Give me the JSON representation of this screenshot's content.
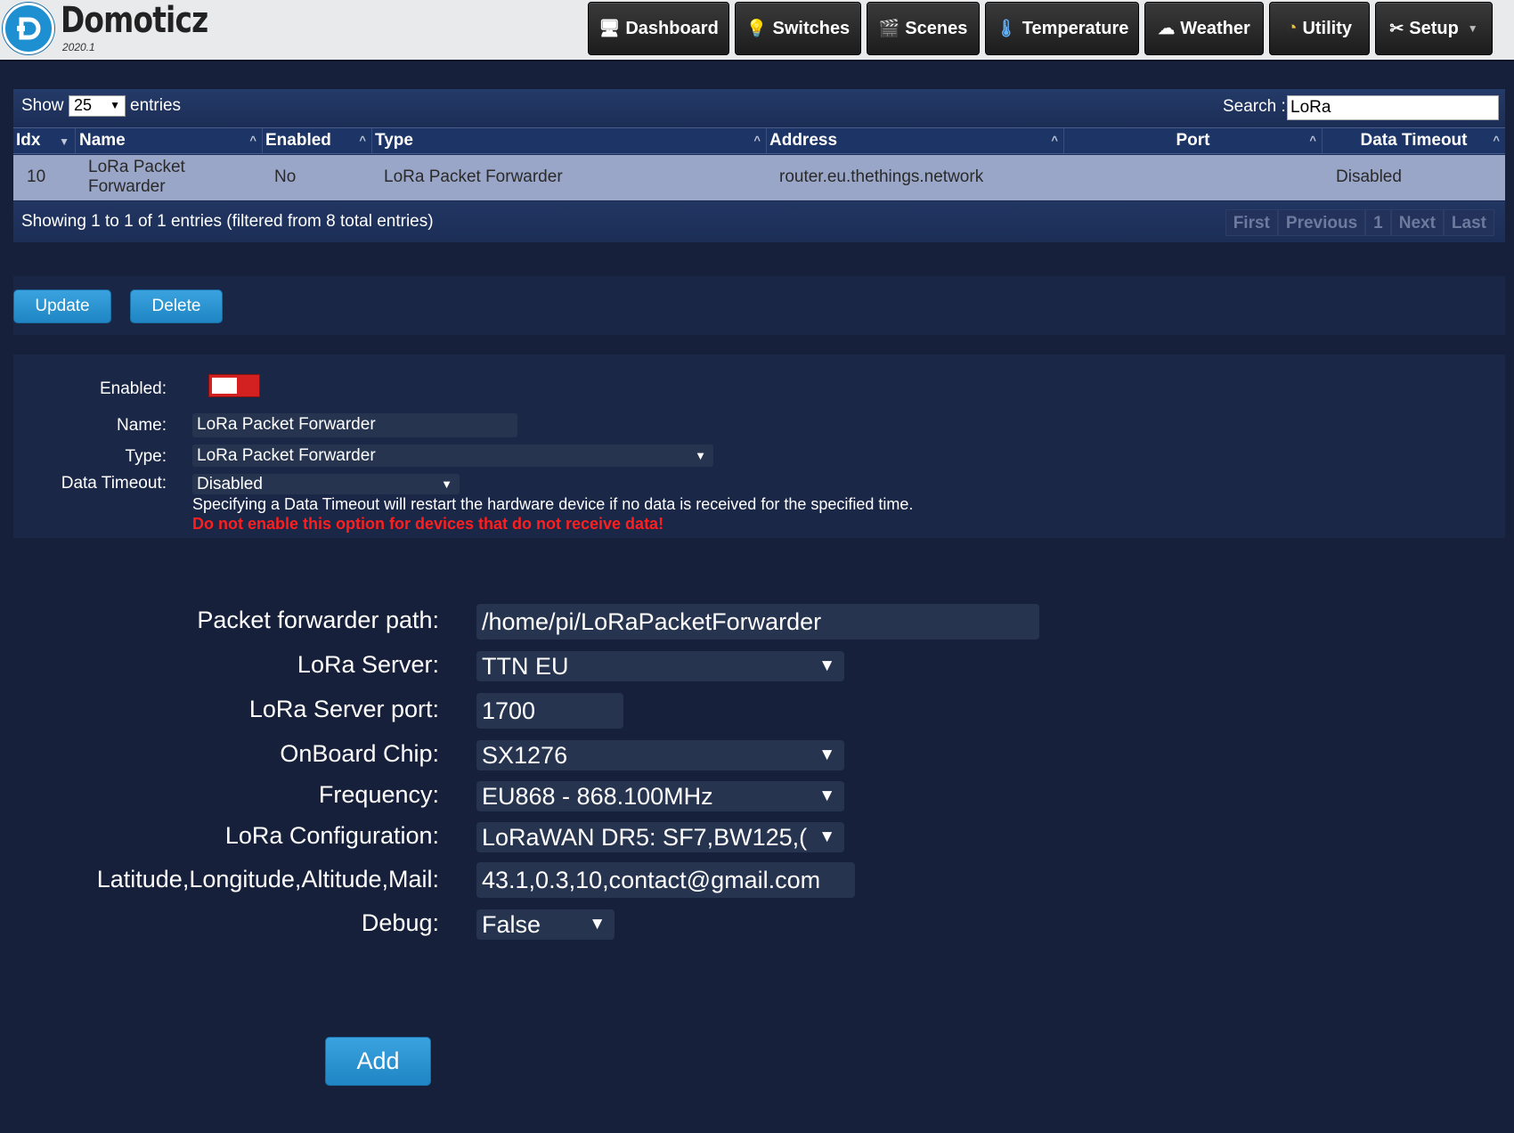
{
  "app": {
    "name": "Domoticz",
    "version": "2020.1"
  },
  "nav": [
    {
      "label": "Dashboard",
      "icon": "dashboard-icon"
    },
    {
      "label": "Switches",
      "icon": "bulb-icon"
    },
    {
      "label": "Scenes",
      "icon": "clapper-icon"
    },
    {
      "label": "Temperature",
      "icon": "thermometer-icon"
    },
    {
      "label": "Weather",
      "icon": "cloud-icon"
    },
    {
      "label": "Utility",
      "icon": "gauge-icon"
    },
    {
      "label": "Setup",
      "icon": "tools-icon"
    }
  ],
  "table": {
    "show_label": "Show",
    "show_value": "25",
    "entries_label": "entries",
    "search_label": "Search :",
    "search_value": "LoRa",
    "columns": [
      "Idx",
      "Name",
      "Enabled",
      "Type",
      "Address",
      "Port",
      "Data Timeout"
    ],
    "rows": [
      {
        "idx": "10",
        "name_line1": "LoRa Packet",
        "name_line2": "Forwarder",
        "enabled": "No",
        "type": "LoRa Packet Forwarder",
        "address": "router.eu.thethings.network",
        "port": "",
        "timeout": "Disabled"
      }
    ],
    "info": "Showing 1 to 1 of 1 entries (filtered from 8 total entries)",
    "paging": [
      "First",
      "Previous",
      "1",
      "Next",
      "Last"
    ]
  },
  "actions": {
    "update": "Update",
    "delete": "Delete"
  },
  "hardware": {
    "enabled_label": "Enabled:",
    "enabled": false,
    "name_label": "Name:",
    "name_value": "LoRa Packet Forwarder",
    "type_label": "Type:",
    "type_value": "LoRa Packet Forwarder",
    "timeout_label": "Data Timeout:",
    "timeout_value": "Disabled",
    "timeout_help": "Specifying a Data Timeout will restart the hardware device if no data is received for the specified time.",
    "timeout_warning": "Do not enable this option for devices that do not receive data!"
  },
  "lora": {
    "path_label": "Packet forwarder path:",
    "path_value": "/home/pi/LoRaPacketForwarder",
    "server_label": "LoRa Server:",
    "server_value": "TTN EU",
    "port_label": "LoRa Server port:",
    "port_value": "1700",
    "chip_label": "OnBoard Chip:",
    "chip_value": "SX1276",
    "freq_label": "Frequency:",
    "freq_value": "EU868 - 868.100MHz",
    "config_label": "LoRa Configuration:",
    "config_value": "LoRaWAN DR5: SF7,BW125,(",
    "latlon_label": "Latitude,Longitude,Altitude,Mail:",
    "latlon_value": "43.1,0.3,10,contact@gmail.com",
    "debug_label": "Debug:",
    "debug_value": "False",
    "add_label": "Add"
  },
  "colors": {
    "accent": "#2a93d5",
    "toggle_off": "#d32020",
    "warning": "#ff1e1e",
    "row": "#9aa6c8",
    "background": "#17203a"
  }
}
